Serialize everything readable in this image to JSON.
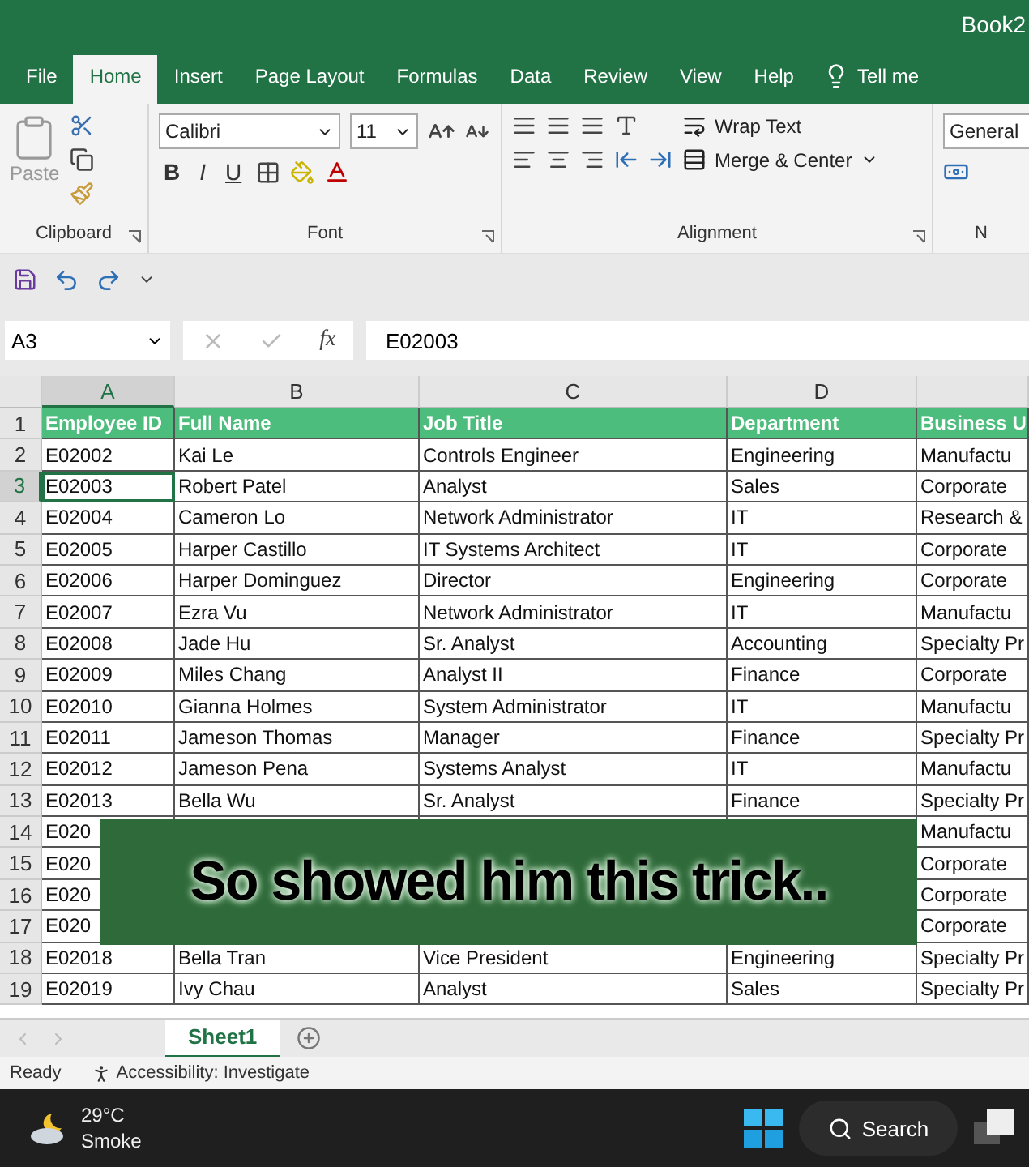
{
  "window": {
    "title": "Book2"
  },
  "ribbon_tabs": [
    {
      "label": "File",
      "selected": false
    },
    {
      "label": "Home",
      "selected": true
    },
    {
      "label": "Insert",
      "selected": false
    },
    {
      "label": "Page Layout",
      "selected": false
    },
    {
      "label": "Formulas",
      "selected": false
    },
    {
      "label": "Data",
      "selected": false
    },
    {
      "label": "Review",
      "selected": false
    },
    {
      "label": "View",
      "selected": false
    },
    {
      "label": "Help",
      "selected": false
    }
  ],
  "tell_me": "Tell me",
  "clipboard": {
    "paste": "Paste",
    "group": "Clipboard"
  },
  "font": {
    "name": "Calibri",
    "size": "11",
    "styles": [
      "B",
      "I",
      "U"
    ],
    "group": "Font"
  },
  "alignment": {
    "wrap": "Wrap Text",
    "merge": "Merge & Center",
    "group": "Alignment"
  },
  "number": {
    "format": "General",
    "group": "N"
  },
  "name_box": "A3",
  "fx": "fx",
  "formula": "E02003",
  "columns": [
    {
      "label": "A",
      "selected": true
    },
    {
      "label": "B",
      "selected": false
    },
    {
      "label": "C",
      "selected": false
    },
    {
      "label": "D",
      "selected": false
    }
  ],
  "rows": [
    {
      "number": "1",
      "kind": "header",
      "selected": false,
      "cells": [
        "Employee ID",
        "Full Name",
        "Job Title",
        "Department",
        "Business U"
      ]
    },
    {
      "number": "2",
      "kind": "data",
      "selected": false,
      "cells": [
        "E02002",
        "Kai Le",
        "Controls Engineer",
        "Engineering",
        "Manufactu"
      ]
    },
    {
      "number": "3",
      "kind": "data",
      "selected": true,
      "cells": [
        "E02003",
        "Robert Patel",
        "Analyst",
        "Sales",
        "Corporate"
      ]
    },
    {
      "number": "4",
      "kind": "data",
      "selected": false,
      "cells": [
        "E02004",
        "Cameron Lo",
        "Network Administrator",
        "IT",
        "Research &"
      ]
    },
    {
      "number": "5",
      "kind": "data",
      "selected": false,
      "cells": [
        "E02005",
        "Harper Castillo",
        "IT Systems Architect",
        "IT",
        "Corporate"
      ]
    },
    {
      "number": "6",
      "kind": "data",
      "selected": false,
      "cells": [
        "E02006",
        "Harper Dominguez",
        "Director",
        "Engineering",
        "Corporate"
      ]
    },
    {
      "number": "7",
      "kind": "data",
      "selected": false,
      "cells": [
        "E02007",
        "Ezra Vu",
        "Network Administrator",
        "IT",
        "Manufactu"
      ]
    },
    {
      "number": "8",
      "kind": "data",
      "selected": false,
      "cells": [
        "E02008",
        "Jade Hu",
        "Sr. Analyst",
        "Accounting",
        "Specialty Pr"
      ]
    },
    {
      "number": "9",
      "kind": "data",
      "selected": false,
      "cells": [
        "E02009",
        "Miles Chang",
        "Analyst II",
        "Finance",
        "Corporate"
      ]
    },
    {
      "number": "10",
      "kind": "data",
      "selected": false,
      "cells": [
        "E02010",
        "Gianna Holmes",
        "System Administrator",
        "IT",
        "Manufactu"
      ]
    },
    {
      "number": "11",
      "kind": "data",
      "selected": false,
      "cells": [
        "E02011",
        "Jameson Thomas",
        "Manager",
        "Finance",
        "Specialty Pr"
      ]
    },
    {
      "number": "12",
      "kind": "data",
      "selected": false,
      "cells": [
        "E02012",
        "Jameson Pena",
        "Systems Analyst",
        "IT",
        "Manufactu"
      ]
    },
    {
      "number": "13",
      "kind": "data",
      "selected": false,
      "cells": [
        "E02013",
        "Bella Wu",
        "Sr. Analyst",
        "Finance",
        "Specialty Pr"
      ]
    },
    {
      "number": "14",
      "kind": "data",
      "selected": false,
      "cells": [
        "E020",
        null,
        null,
        null,
        "Manufactu"
      ]
    },
    {
      "number": "15",
      "kind": "data",
      "selected": false,
      "cells": [
        "E020",
        null,
        null,
        null,
        "Corporate"
      ]
    },
    {
      "number": "16",
      "kind": "data",
      "selected": false,
      "cells": [
        "E020",
        null,
        null,
        null,
        "Corporate"
      ]
    },
    {
      "number": "17",
      "kind": "data",
      "selected": false,
      "cells": [
        "E020",
        null,
        null,
        null,
        "Corporate"
      ]
    },
    {
      "number": "18",
      "kind": "data",
      "selected": false,
      "cells": [
        "E02018",
        "Bella Tran",
        "Vice President",
        "Engineering",
        "Specialty Pr"
      ]
    },
    {
      "number": "19",
      "kind": "data",
      "selected": false,
      "cells": [
        "E02019",
        "Ivy Chau",
        "Analyst",
        "Sales",
        "Specialty Pr"
      ]
    }
  ],
  "sheet_tabs": [
    {
      "label": "Sheet1",
      "selected": true
    }
  ],
  "status": {
    "ready": "Ready",
    "accessibility": "Accessibility: Investigate"
  },
  "taskbar": {
    "temperature": "29°C",
    "weather": "Smoke",
    "search": "Search"
  },
  "caption": "So showed him this trick.."
}
